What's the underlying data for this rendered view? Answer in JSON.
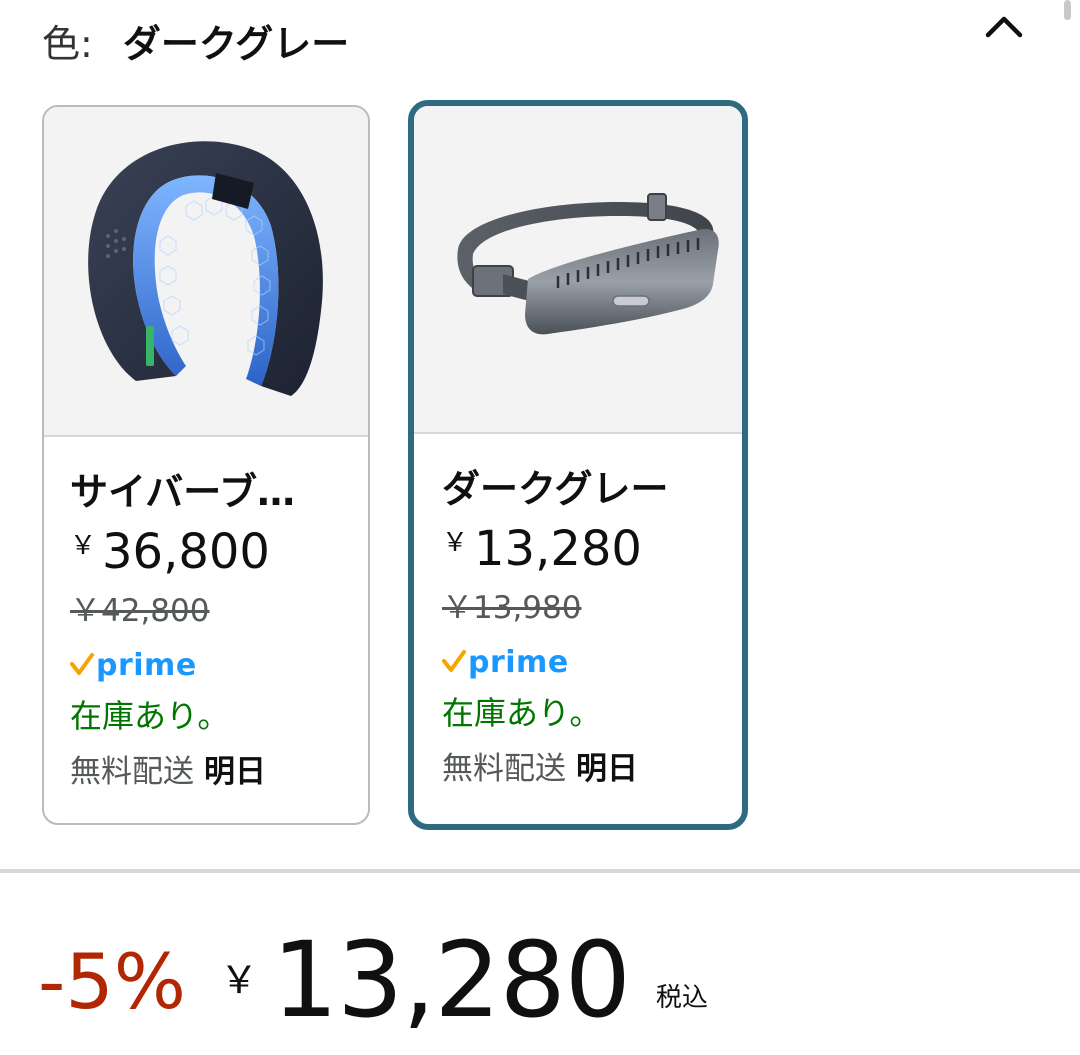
{
  "header": {
    "color_label": "色:",
    "selected_color": "ダークグレー",
    "collapse_icon": "chevron-up-icon"
  },
  "variants": [
    {
      "title": "サイバーブ…",
      "price_symbol": "￥",
      "price": "36,800",
      "list_price": "￥42,800",
      "prime_label": "prime",
      "stock": "在庫あり。",
      "delivery_label": "無料配送",
      "delivery_date": "明日",
      "image": "neck-cooler-image",
      "selected": false
    },
    {
      "title": "ダークグレー",
      "price_symbol": "￥",
      "price": "13,280",
      "list_price": "￥13,980",
      "prime_label": "prime",
      "stock": "在庫あり。",
      "delivery_label": "無料配送",
      "delivery_date": "明日",
      "image": "waist-belt-fan-image",
      "selected": true
    }
  ],
  "price_summary": {
    "discount": "-5%",
    "currency_symbol": "￥",
    "price": "13,280",
    "tax_label": "税込"
  },
  "colors": {
    "selected_border": "#2e6b80",
    "discount": "#b12704",
    "in_stock": "#007600",
    "prime_blue": "#1a98ff",
    "prime_check": "#f7a300"
  }
}
